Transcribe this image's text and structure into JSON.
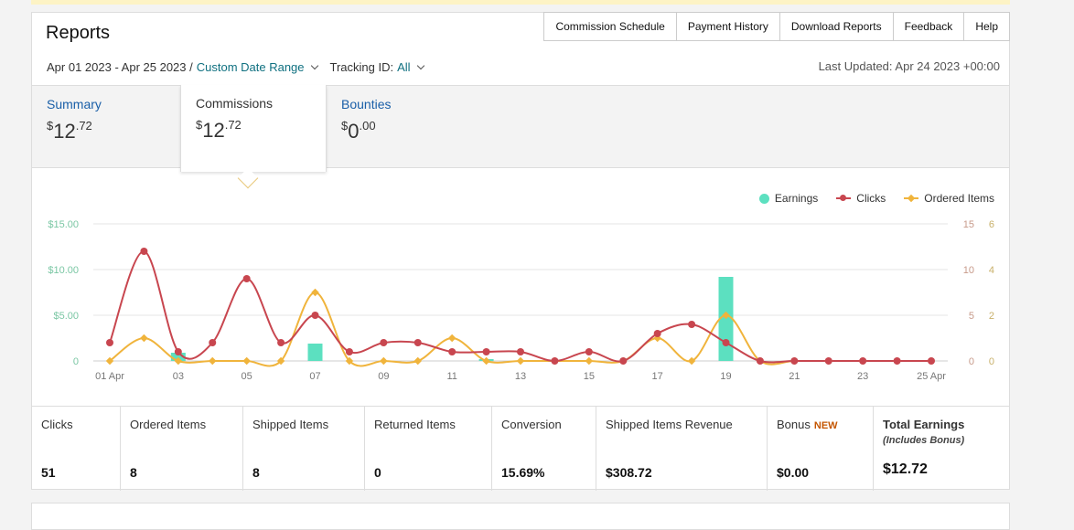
{
  "header": {
    "title": "Reports",
    "links": [
      "Commission Schedule",
      "Payment History",
      "Download Reports",
      "Feedback",
      "Help"
    ],
    "date_range": "Apr 01 2023 - Apr 25 2023 /",
    "custom_range": "Custom Date Range",
    "tracking_label": "Tracking ID:",
    "tracking_value": "All",
    "last_updated": "Last Updated: Apr 24 2023 +00:00"
  },
  "tabs": [
    {
      "label": "Summary",
      "currency": "$",
      "whole": "12",
      "cents": ".72"
    },
    {
      "label": "Commissions",
      "currency": "$",
      "whole": "12",
      "cents": ".72"
    },
    {
      "label": "Bounties",
      "currency": "$",
      "whole": "0",
      "cents": ".00"
    }
  ],
  "legend": {
    "earnings": "Earnings",
    "clicks": "Clicks",
    "ordered": "Ordered Items"
  },
  "colors": {
    "earnings": "#5ce0c0",
    "clicks": "#c8464f",
    "ordered": "#f0b43c"
  },
  "chart_data": {
    "type": "line",
    "x": [
      "01 Apr",
      "02",
      "03",
      "04",
      "05",
      "06",
      "07",
      "08",
      "09",
      "10",
      "11",
      "12",
      "13",
      "14",
      "15",
      "16",
      "17",
      "18",
      "19",
      "20",
      "21",
      "22",
      "23",
      "24",
      "25 Apr"
    ],
    "x_tick_labels": [
      "01 Apr",
      "03",
      "05",
      "07",
      "09",
      "11",
      "13",
      "15",
      "17",
      "19",
      "21",
      "23",
      "25 Apr"
    ],
    "y_left_ticks": [
      "$15.00",
      "$10.00",
      "$5.00",
      "0"
    ],
    "y_mid_ticks": [
      "15",
      "10",
      "5",
      "0"
    ],
    "y_right_ticks": [
      "6",
      "4",
      "2",
      "0"
    ],
    "y_left_range": [
      0,
      15
    ],
    "y_mid_range": [
      0,
      15
    ],
    "y_right_range": [
      0,
      6
    ],
    "series": [
      {
        "name": "Earnings",
        "type": "bar",
        "axis": "left",
        "values": [
          0,
          0,
          0.9,
          0,
          0,
          0,
          1.9,
          0,
          0,
          0,
          0,
          0.2,
          0,
          0,
          0,
          0,
          0,
          0,
          9.2,
          0,
          0,
          0,
          0,
          0,
          0
        ]
      },
      {
        "name": "Clicks",
        "type": "line",
        "axis": "mid",
        "values": [
          2,
          12,
          1,
          2,
          9,
          2,
          5,
          1,
          2,
          2,
          1,
          1,
          1,
          0,
          1,
          0,
          3,
          4,
          2,
          0,
          0,
          0,
          0,
          0,
          0
        ]
      },
      {
        "name": "Ordered Items",
        "type": "line",
        "axis": "right",
        "values": [
          0,
          1,
          0,
          0,
          0,
          0,
          3,
          0,
          0,
          0,
          1,
          0,
          0,
          0,
          0,
          0,
          1,
          0,
          2,
          0,
          0,
          0,
          0,
          0,
          0
        ]
      }
    ],
    "grid": true,
    "legend_position": "top-right"
  },
  "metrics": [
    {
      "label": "Clicks",
      "value": "51"
    },
    {
      "label": "Ordered Items",
      "value": "8"
    },
    {
      "label": "Shipped Items",
      "value": "8"
    },
    {
      "label": "Returned Items",
      "value": "0"
    },
    {
      "label": "Conversion",
      "value": "15.69%"
    },
    {
      "label": "Shipped Items Revenue",
      "value": "$308.72"
    },
    {
      "label": "Bonus",
      "badge": "NEW",
      "value": "$0.00"
    },
    {
      "label": "Total Earnings",
      "sub": "(Includes Bonus)",
      "value": "$12.72"
    }
  ]
}
